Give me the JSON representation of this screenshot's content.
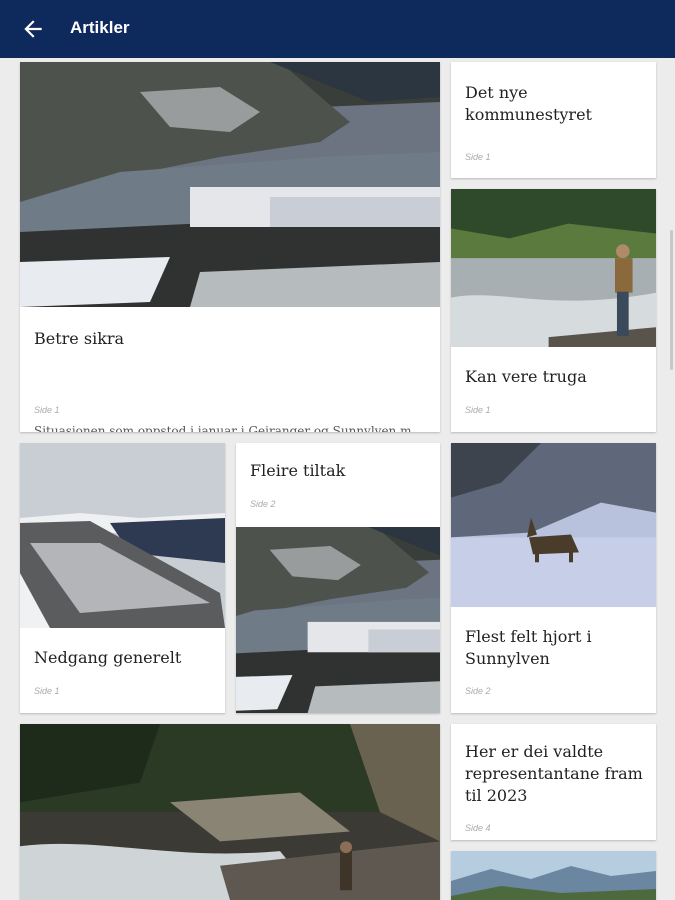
{
  "appbar": {
    "title": "Artikler",
    "back_icon": "arrow-back-icon",
    "background": "#0e2a5c"
  },
  "articles": [
    {
      "title": "Betre sikra",
      "summary": "Situasjonen som oppstod i januar i Geiranger og Sunnylven me...",
      "page": "Side 1",
      "image": "fjord-village-winter"
    },
    {
      "title": "Det nye kommunestyret",
      "page": "Side 1"
    },
    {
      "title": "Kan vere truga",
      "page": "Side 1",
      "image": "angler-in-river"
    },
    {
      "title": "Nedgang generelt",
      "page": "Side 1",
      "image": "snowy-valley"
    },
    {
      "title": "Fleire tiltak",
      "page": "Side 2",
      "image": "fjord-village-winter"
    },
    {
      "title": "Flest felt hjort i Sunnylven",
      "page": "Side 2",
      "image": "deer-in-snow"
    },
    {
      "title": "Her er dei valdte representantane fram til 2023",
      "page": "Side 4"
    },
    {
      "image": "forest-river-fisherman"
    },
    {
      "image": "mountain-landscape"
    }
  ]
}
